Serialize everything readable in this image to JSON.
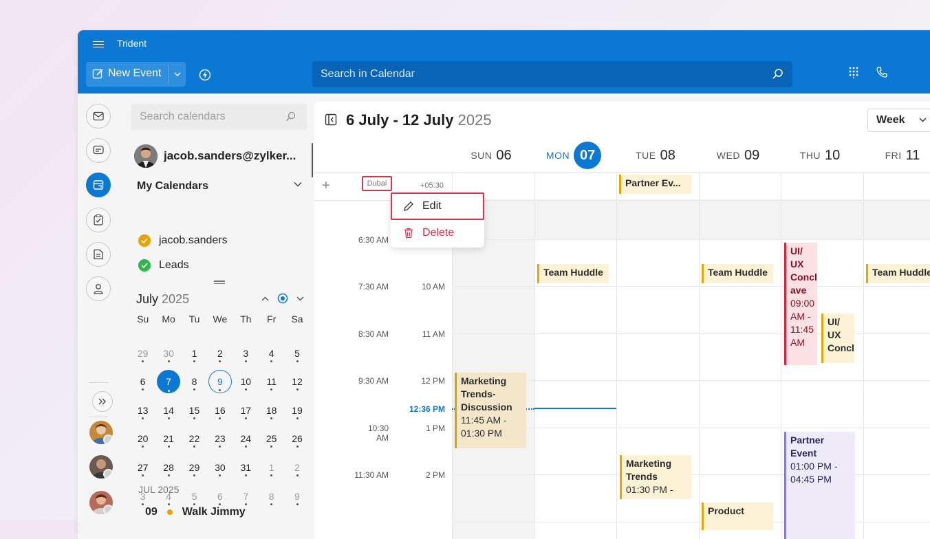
{
  "app": {
    "title": "Trident"
  },
  "toolbar": {
    "new_event_label": "New Event",
    "search_placeholder": "Search in Calendar"
  },
  "sidebar": {
    "search_placeholder": "Search calendars",
    "user_email": "jacob.sanders@zylker...",
    "my_calendars_label": "My Calendars",
    "calendars": [
      {
        "name": "jacob.sanders",
        "color": "#e8a300"
      },
      {
        "name": "Leads",
        "color": "#2fb54a"
      }
    ],
    "mini_cal": {
      "month": "July",
      "year": "2025",
      "weekdays": [
        "Su",
        "Mo",
        "Tu",
        "We",
        "Th",
        "Fr",
        "Sa"
      ],
      "weeks": [
        [
          "29",
          "30",
          "1",
          "2",
          "3",
          "4",
          "5"
        ],
        [
          "6",
          "7",
          "8",
          "9",
          "10",
          "11",
          "12"
        ],
        [
          "13",
          "14",
          "15",
          "16",
          "17",
          "18",
          "19"
        ],
        [
          "20",
          "21",
          "22",
          "23",
          "24",
          "25",
          "26"
        ],
        [
          "27",
          "28",
          "29",
          "30",
          "31",
          "1",
          "2"
        ],
        [
          "3",
          "4",
          "5",
          "6",
          "7",
          "8",
          "9"
        ]
      ]
    },
    "agenda": {
      "month_label": "JUL 2025",
      "day": "09",
      "title": "Walk Jimmy"
    }
  },
  "calendar": {
    "range_title": "6 July - 12 July",
    "range_year": "2025",
    "view_label": "Week",
    "days": [
      {
        "name": "SUN",
        "date": "06"
      },
      {
        "name": "MON",
        "date": "07",
        "today": true
      },
      {
        "name": "TUE",
        "date": "08"
      },
      {
        "name": "WED",
        "date": "09"
      },
      {
        "name": "THU",
        "date": "10"
      },
      {
        "name": "FRI",
        "date": "11"
      }
    ],
    "tz_label": "Dubai",
    "tz_offset": "+05:30",
    "times_left": [
      "6:30 AM",
      "7:30 AM",
      "8:30 AM",
      "9:30 AM",
      "10:30 AM",
      "11:30 AM"
    ],
    "times_right": [
      "10 AM",
      "11 AM",
      "12 PM",
      "1 PM",
      "2 PM"
    ],
    "now_time": "12:36 PM",
    "events": {
      "partner_allday": "Partner Ev...",
      "huddle_mon": "Team Huddle",
      "huddle_wed": "Team Huddle",
      "huddle_fri": "Team Huddle",
      "uiux_thu_title": "UI/ UX Concl ave",
      "uiux_thu_time": "09:00 AM - 11:45 AM",
      "uiux_thu2_title": "UI/ UX Concl",
      "marketing_sun_title": "Marketing Trends- Discussion",
      "marketing_sun_time": "11:45 AM - 01:30 PM",
      "partner_thu_title": "Partner Event",
      "partner_thu_time": "01:00 PM - 04:45 PM",
      "marketing_tue_title": "Marketing Trends",
      "marketing_tue_time": "01:30 PM -",
      "product_wed_title": "Product"
    }
  },
  "context_menu": {
    "edit": "Edit",
    "delete": "Delete"
  }
}
